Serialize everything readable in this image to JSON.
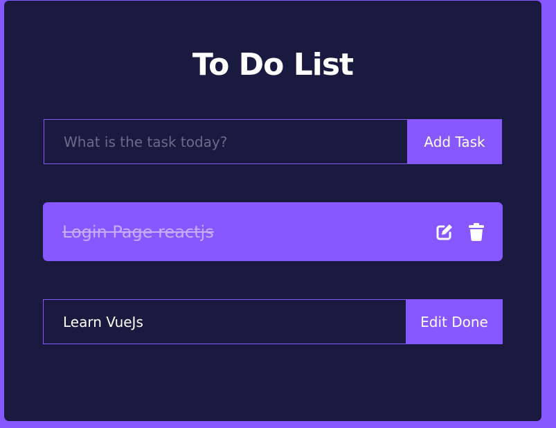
{
  "app": {
    "title": "To Do List"
  },
  "add_form": {
    "placeholder": "What is the task today?",
    "value": "",
    "button_label": "Add Task"
  },
  "todos": [
    {
      "text": "Login Page reactjs",
      "completed": true,
      "icons": [
        "edit-icon",
        "trash-icon"
      ]
    }
  ],
  "edit_form": {
    "value": "Learn VueJs",
    "button_label": "Edit Done"
  },
  "colors": {
    "background": "#8758ff",
    "card": "#1a1a40",
    "accent": "#8758ff",
    "text": "#ffffff",
    "completed_text": "#c5aeff",
    "placeholder": "#6b6b88"
  }
}
